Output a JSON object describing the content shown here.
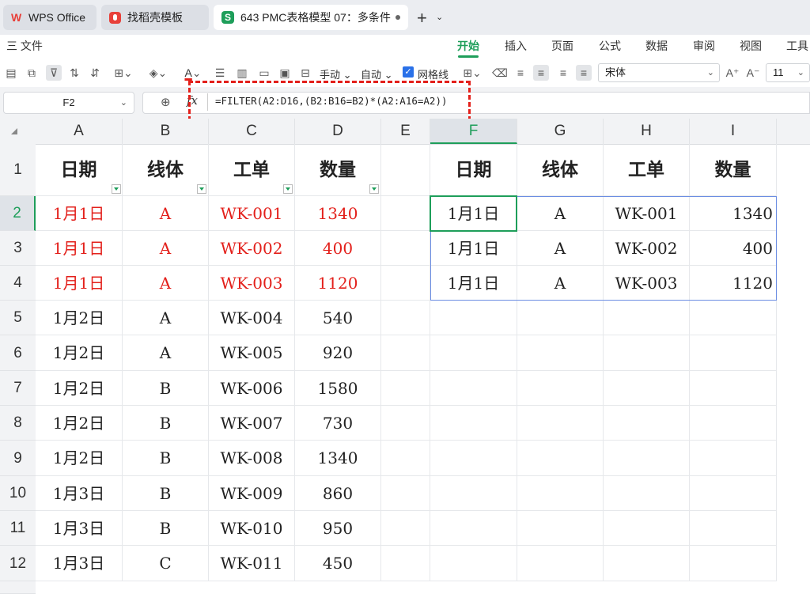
{
  "tabs": [
    {
      "label": "WPS Office",
      "icon": "wps-logo-icon"
    },
    {
      "label": "找稻壳模板",
      "icon": "docer-icon"
    },
    {
      "label": "643 PMC表格模型 07：多条件筛选",
      "icon": "spreadsheet-icon"
    }
  ],
  "menu": {
    "file": "三 文件",
    "items": [
      "开始",
      "插入",
      "页面",
      "公式",
      "数据",
      "审阅",
      "视图",
      "工具"
    ]
  },
  "toolbar": {
    "manual": "手动",
    "auto": "自动",
    "gridlines": "网格线",
    "font": "宋体",
    "size": "11"
  },
  "formula_bar": {
    "name_box": "F2",
    "fx": "fx",
    "formula": "=FILTER(A2:D16,(B2:B16=B2)*(A2:A16=A2))"
  },
  "columns": [
    "A",
    "B",
    "C",
    "D",
    "E",
    "F",
    "G",
    "H",
    "I"
  ],
  "rows": [
    "1",
    "2",
    "3",
    "4",
    "5",
    "6",
    "7",
    "8",
    "9",
    "10",
    "11",
    "12"
  ],
  "source_header": [
    "日期",
    "线体",
    "工单",
    "数量"
  ],
  "source_rows": [
    [
      "1月1日",
      "A",
      "WK-001",
      "1340"
    ],
    [
      "1月1日",
      "A",
      "WK-002",
      "400"
    ],
    [
      "1月1日",
      "A",
      "WK-003",
      "1120"
    ],
    [
      "1月2日",
      "A",
      "WK-004",
      "540"
    ],
    [
      "1月2日",
      "A",
      "WK-005",
      "920"
    ],
    [
      "1月2日",
      "B",
      "WK-006",
      "1580"
    ],
    [
      "1月2日",
      "B",
      "WK-007",
      "730"
    ],
    [
      "1月2日",
      "B",
      "WK-008",
      "1340"
    ],
    [
      "1月3日",
      "B",
      "WK-009",
      "860"
    ],
    [
      "1月3日",
      "B",
      "WK-010",
      "950"
    ],
    [
      "1月3日",
      "C",
      "WK-011",
      "450"
    ]
  ],
  "result_header": [
    "日期",
    "线体",
    "工单",
    "数量"
  ],
  "result_rows": [
    [
      "1月1日",
      "A",
      "WK-001",
      "1340"
    ],
    [
      "1月1日",
      "A",
      "WK-002",
      "400"
    ],
    [
      "1月1日",
      "A",
      "WK-003",
      "1120"
    ]
  ],
  "colors": {
    "highlight_text": "#e3201b",
    "accent": "#1e9e5a",
    "annotation": "#e3201b"
  }
}
